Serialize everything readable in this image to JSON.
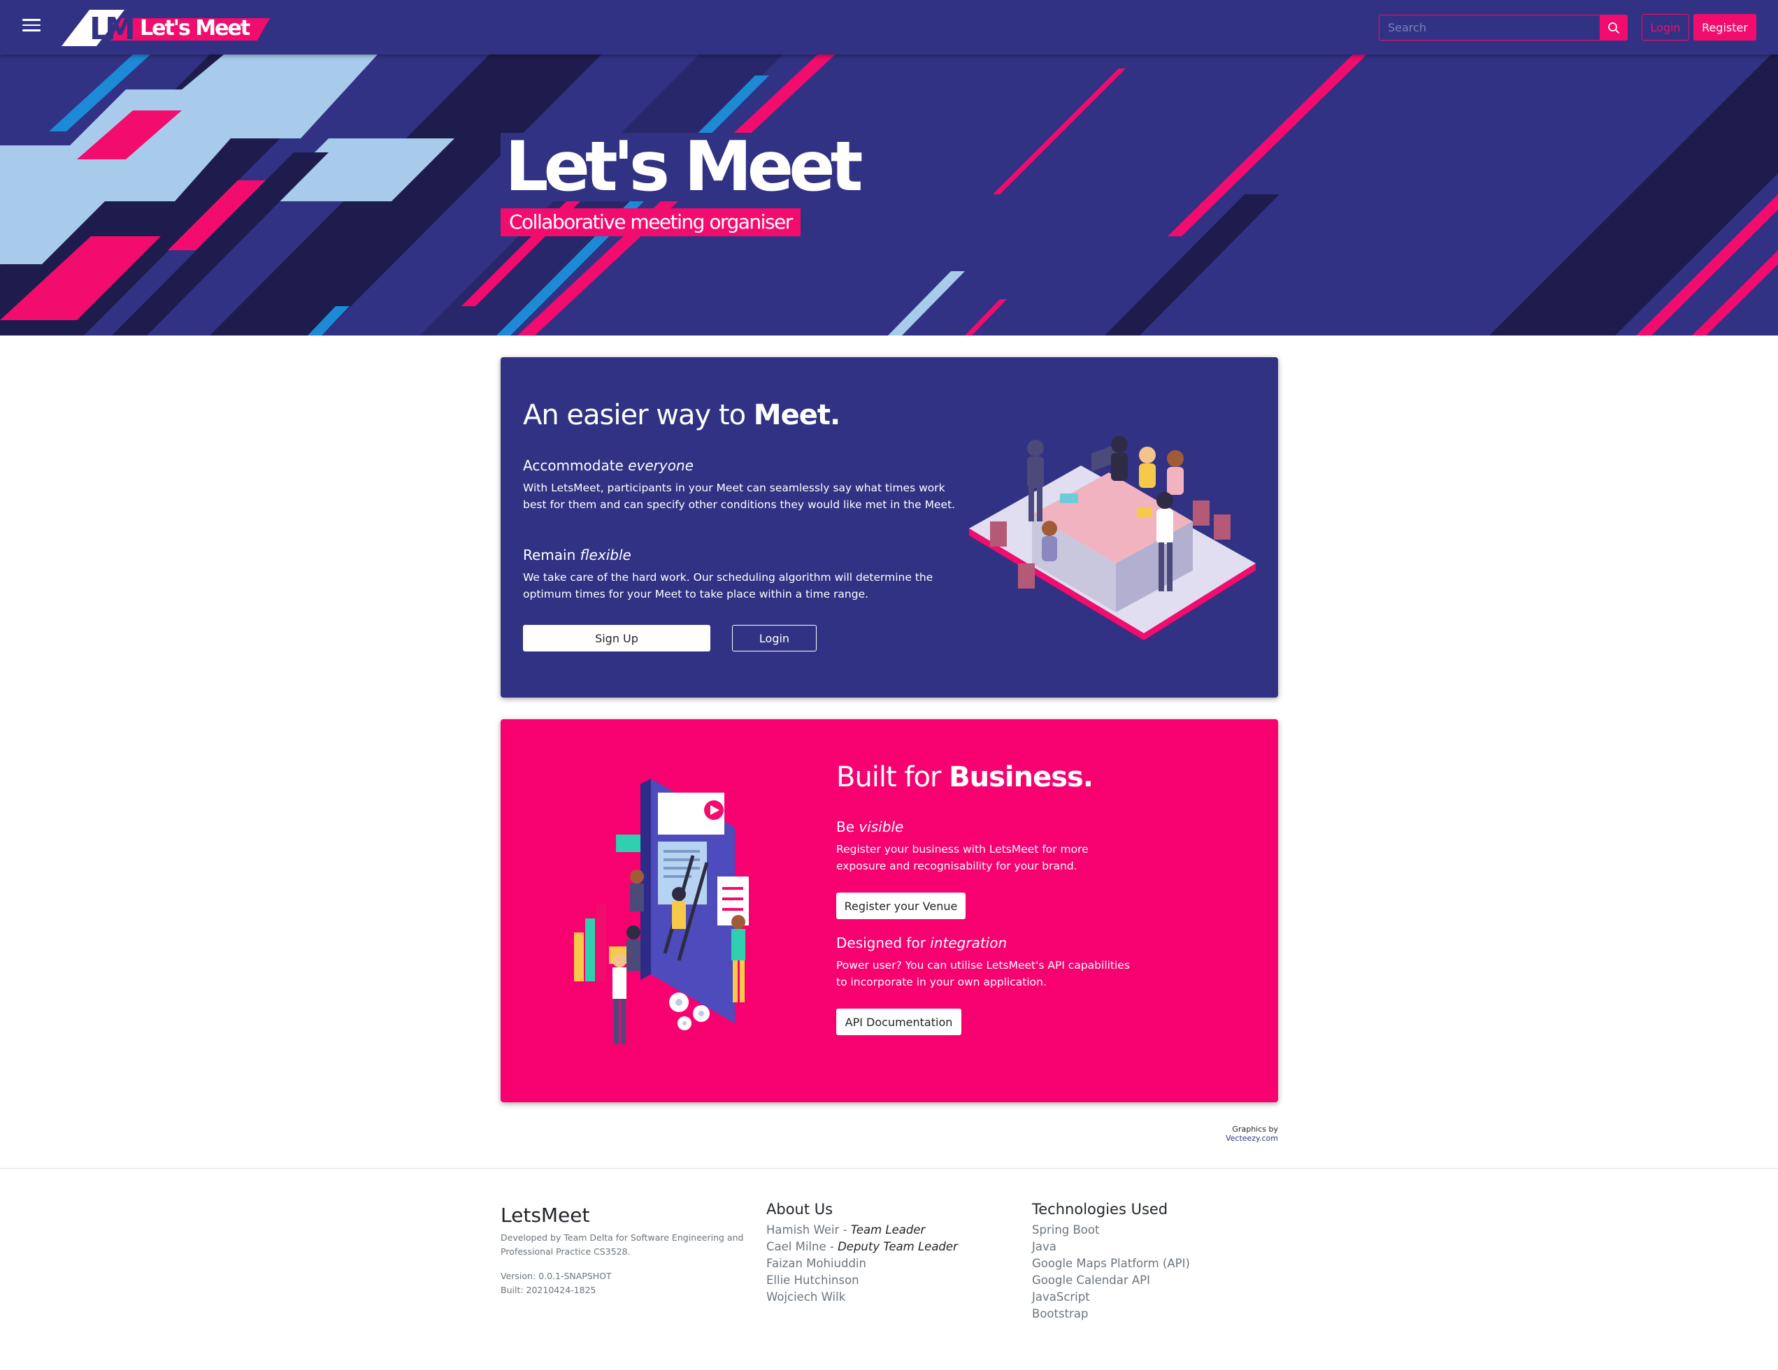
{
  "navbar": {
    "brand_logo_letters": "LM",
    "brand_name": "Let's Meet",
    "search_placeholder": "Search",
    "login_label": "Login",
    "register_label": "Register"
  },
  "hero": {
    "title": "Let's Meet",
    "subtitle": "Collaborative meeting organiser"
  },
  "card_meet": {
    "heading_normal": "An easier way to ",
    "heading_bold": "Meet.",
    "sections": [
      {
        "title_normal": "Accommodate ",
        "title_italic": "everyone",
        "text": "With LetsMeet, participants in your Meet can seamlessly say what times work best for them and can specify other conditions they would like met in the Meet."
      },
      {
        "title_normal": "Remain ",
        "title_italic": "flexible",
        "text": "We take care of the hard work. Our scheduling algorithm will determine the optimum times for your Meet to take place within a time range."
      }
    ],
    "signup_label": "Sign Up",
    "login_label": "Login"
  },
  "card_business": {
    "heading_normal": "Built for ",
    "heading_bold": "Business.",
    "sections": [
      {
        "title_normal": "Be ",
        "title_italic": "visible",
        "text": "Register your business with LetsMeet for more exposure and recognisability for your brand.",
        "button": "Register your Venue"
      },
      {
        "title_normal": "Designed for ",
        "title_italic": "integration",
        "text": "Power user? You can utilise LetsMeet's API capabilities to incorporate in your own application.",
        "button": "API Documentation"
      }
    ]
  },
  "credit": {
    "prefix": "Graphics by ",
    "link": "Vecteezy.com"
  },
  "footer": {
    "brand": "LetsMeet",
    "developed": "Developed by Team Delta for Software Engineering and Professional Practice CS3528.",
    "version": "Version: 0.0.1-SNAPSHOT",
    "built": "Built: 20210424-1825",
    "about": {
      "title": "About Us",
      "members": [
        {
          "name": "Hamish Weir",
          "role": "Team Leader"
        },
        {
          "name": "Cael Milne",
          "role": "Deputy Team Leader"
        },
        {
          "name": "Faizan Mohiuddin",
          "role": ""
        },
        {
          "name": "Ellie Hutchinson",
          "role": ""
        },
        {
          "name": "Wojciech Wilk",
          "role": ""
        }
      ]
    },
    "tech": {
      "title": "Technologies Used",
      "items": [
        "Spring Boot",
        "Java",
        "Google Maps Platform (API)",
        "Google Calendar API",
        "JavaScript",
        "Bootstrap"
      ]
    }
  },
  "colors": {
    "navy": "#313283",
    "pink": "#f20c6d",
    "card_pink": "#f70170",
    "light_blue": "#a8cbec",
    "blue": "#1d8ad6",
    "dark": "#1e1b4d"
  }
}
